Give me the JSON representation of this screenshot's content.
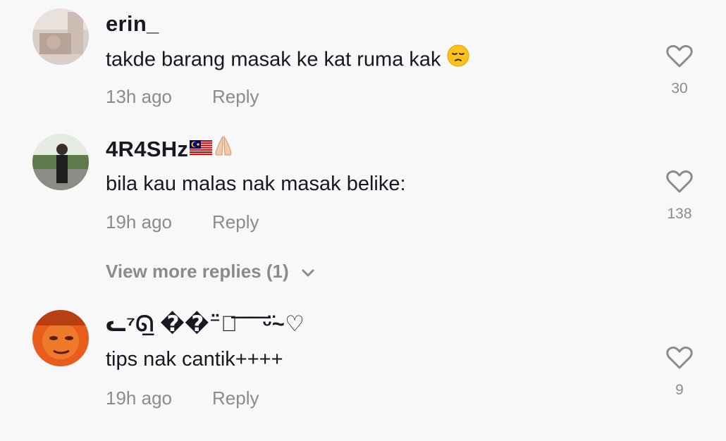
{
  "comments": [
    {
      "username": "erin_",
      "text": "takde barang masak ke kat ruma kak",
      "time": "13h ago",
      "reply_label": "Reply",
      "likes": "30",
      "avatar_icon": "avatar-photo"
    },
    {
      "username": "4R4SHz",
      "text": "bila kau malas nak masak belike:",
      "time": "19h ago",
      "reply_label": "Reply",
      "likes": "138",
      "avatar_icon": "avatar-photo"
    },
    {
      "username": "ᓚ⁷ᘏ̲ ��⁻̈ৡ͞ ͞ ͞ ͞ ᵕ̈~♡",
      "text": "tips nak cantik++++",
      "time": "19h ago",
      "reply_label": "Reply",
      "likes": "9",
      "avatar_icon": "avatar-photo"
    }
  ],
  "view_more_replies": "View more replies (1)",
  "colors": {
    "background": "#f8f8f8",
    "primary_text": "#161823",
    "secondary_text": "#8a8b91"
  }
}
